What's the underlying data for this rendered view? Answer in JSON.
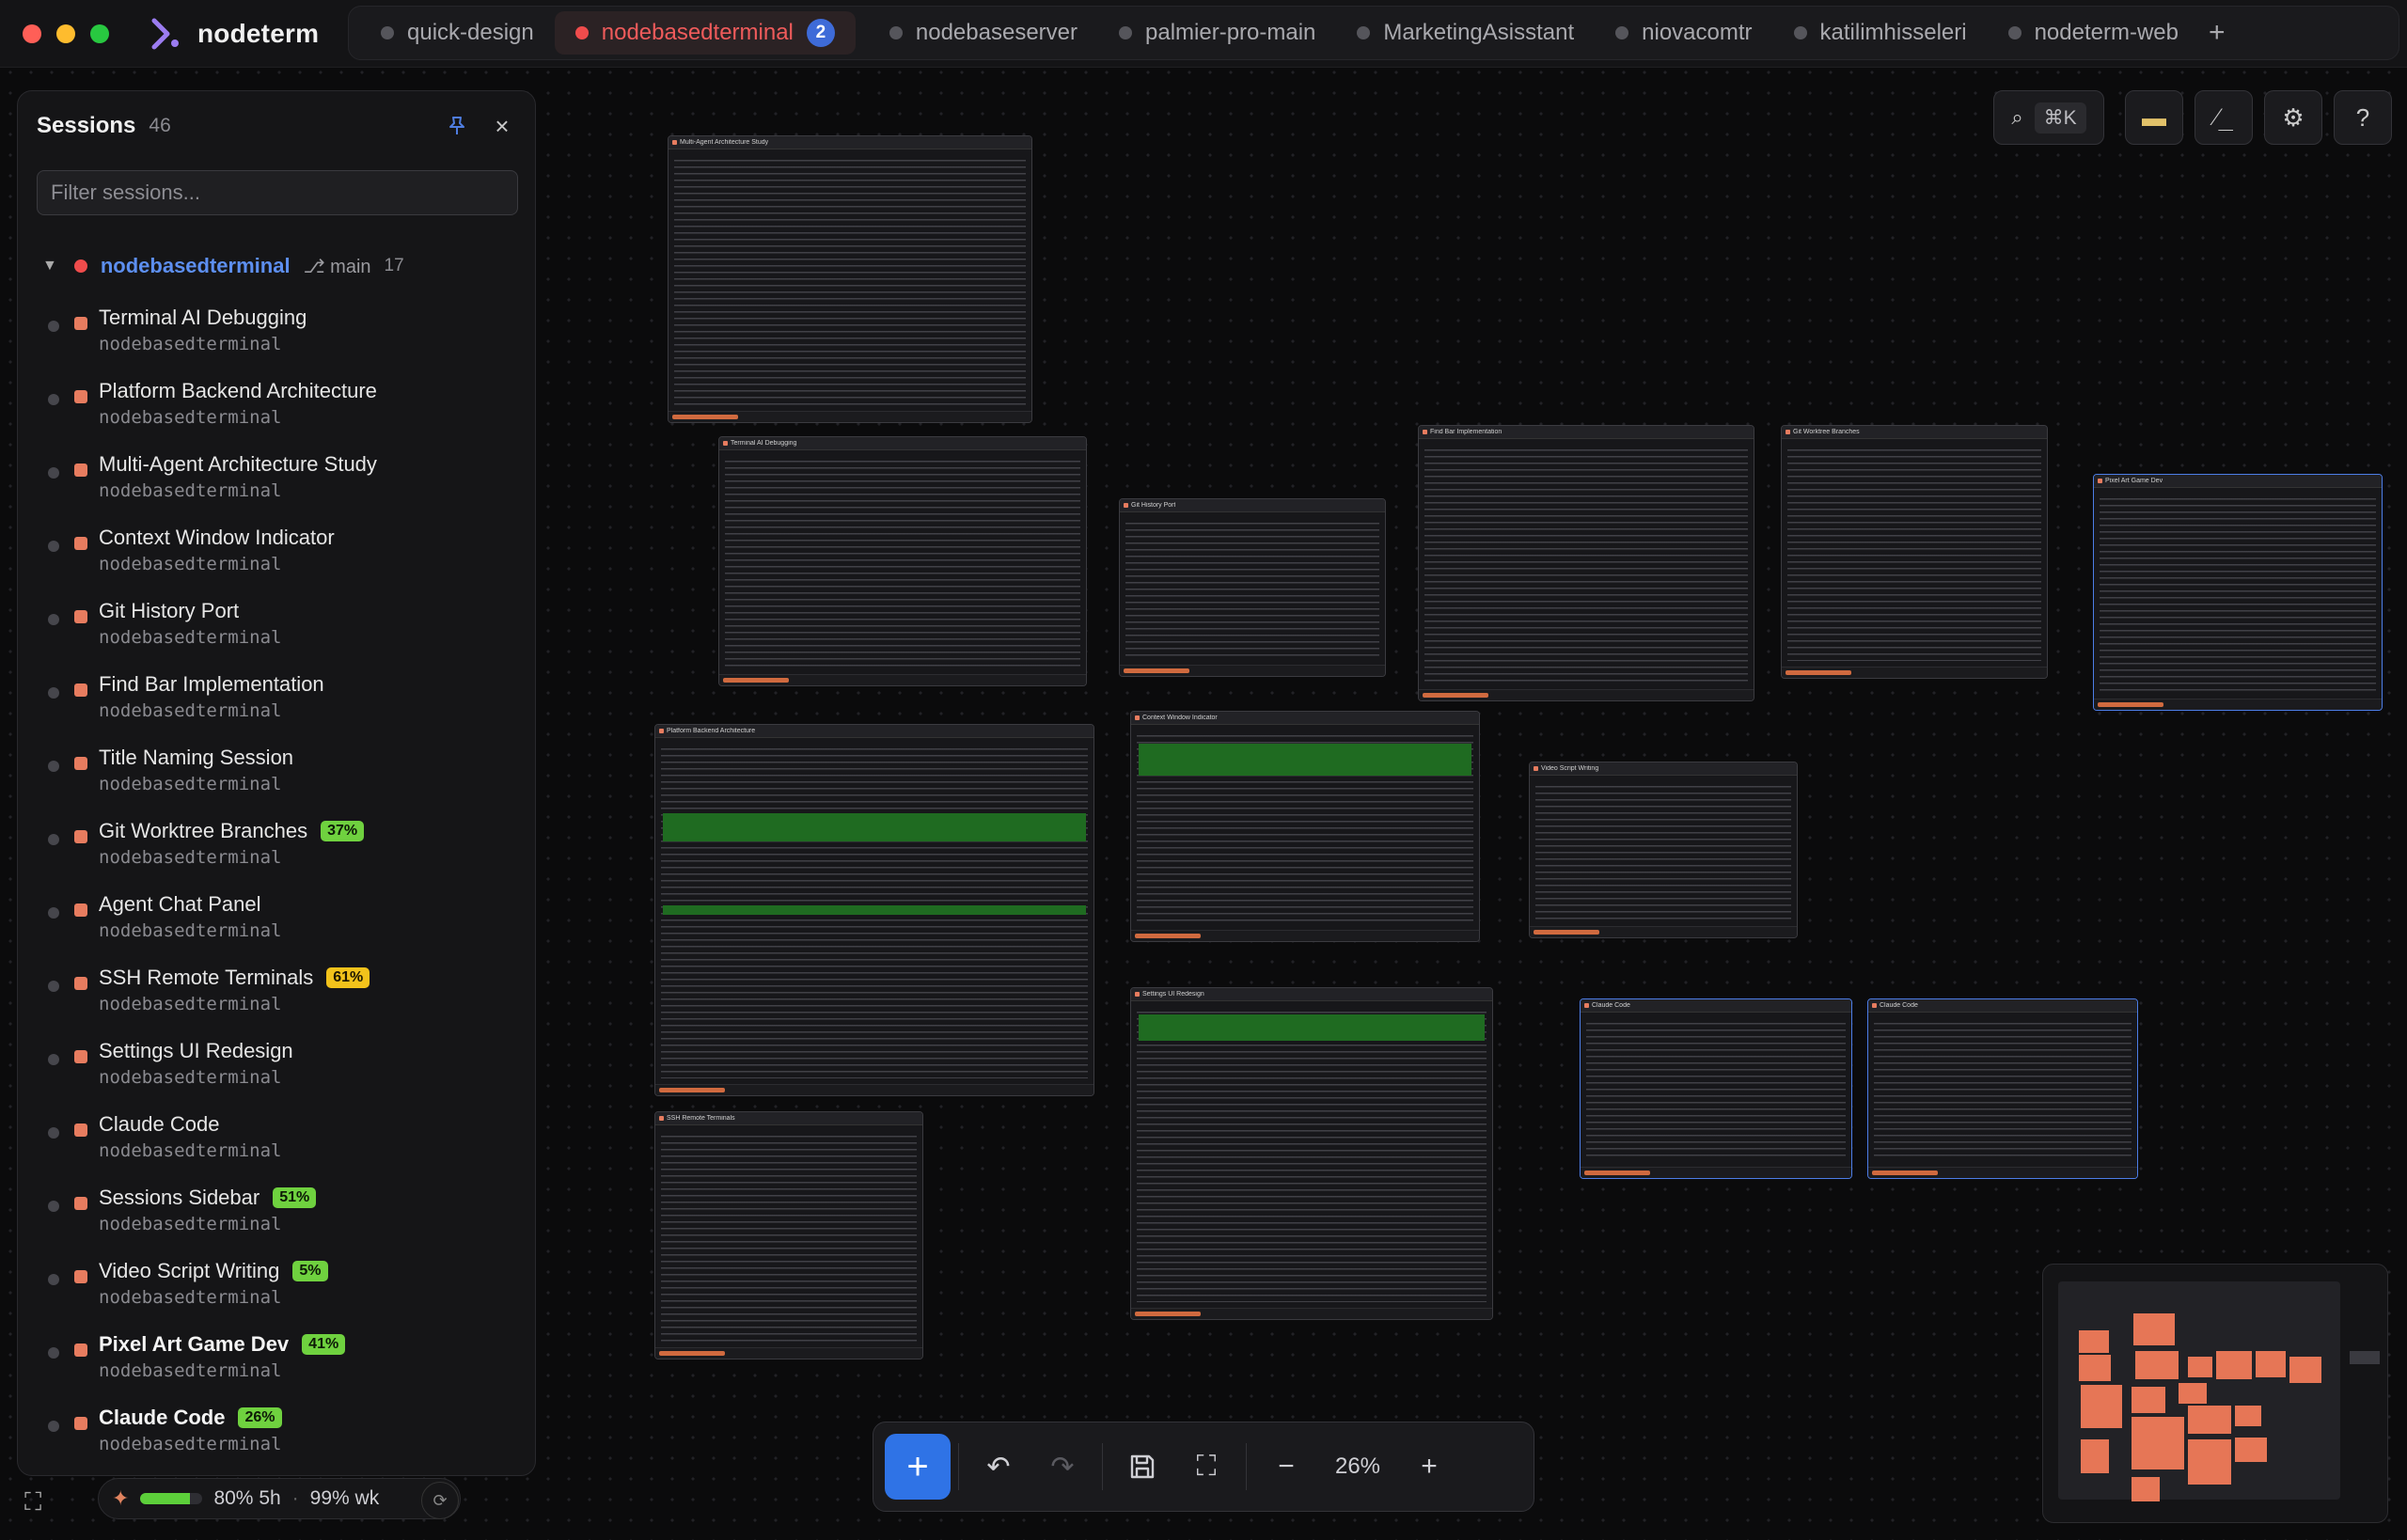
{
  "app": {
    "name": "nodeterm"
  },
  "traffic_colors": {
    "close": "#ff5f57",
    "minimize": "#febc2e",
    "maximize": "#28c840"
  },
  "tabs": [
    {
      "label": "quick-design",
      "active": false
    },
    {
      "label": "nodebasedterminal",
      "active": true,
      "badge": "2"
    },
    {
      "label": "nodebaseserver",
      "active": false
    },
    {
      "label": "palmier-pro-main",
      "active": false
    },
    {
      "label": "MarketingAsisstant",
      "active": false
    },
    {
      "label": "niovacomtr",
      "active": false
    },
    {
      "label": "katilimhisseleri",
      "active": false
    },
    {
      "label": "nodeterm-web",
      "active": false
    }
  ],
  "tabs_add": "+",
  "sidebar": {
    "title": "Sessions",
    "count": "46",
    "filter_placeholder": "Filter sessions...",
    "close": "×",
    "group": {
      "name": "nodebasedterminal",
      "branch": "main",
      "count": "17"
    },
    "sessions": [
      {
        "title": "Terminal AI Debugging",
        "project": "nodebasedterminal"
      },
      {
        "title": "Platform Backend Architecture",
        "project": "nodebasedterminal"
      },
      {
        "title": "Multi-Agent Architecture Study",
        "project": "nodebasedterminal"
      },
      {
        "title": "Context Window Indicator",
        "project": "nodebasedterminal"
      },
      {
        "title": "Git History Port",
        "project": "nodebasedterminal"
      },
      {
        "title": "Find Bar Implementation",
        "project": "nodebasedterminal"
      },
      {
        "title": "Title Naming Session",
        "project": "nodebasedterminal"
      },
      {
        "title": "Git Worktree Branches",
        "project": "nodebasedterminal",
        "pct": "37%",
        "pct_color": "green"
      },
      {
        "title": "Agent Chat Panel",
        "project": "nodebasedterminal"
      },
      {
        "title": "SSH Remote Terminals",
        "project": "nodebasedterminal",
        "pct": "61%",
        "pct_color": "yellow"
      },
      {
        "title": "Settings UI Redesign",
        "project": "nodebasedterminal"
      },
      {
        "title": "Claude Code",
        "project": "nodebasedterminal"
      },
      {
        "title": "Sessions Sidebar",
        "project": "nodebasedterminal",
        "pct": "51%",
        "pct_color": "green"
      },
      {
        "title": "Video Script Writing",
        "project": "nodebasedterminal",
        "pct": "5%",
        "pct_color": "green"
      },
      {
        "title": "Pixel Art Game Dev",
        "project": "nodebasedterminal",
        "pct": "41%",
        "pct_color": "green",
        "bold": true
      },
      {
        "title": "Claude Code",
        "project": "nodebasedterminal",
        "pct": "26%",
        "pct_color": "green",
        "bold": true
      }
    ]
  },
  "usage": {
    "session_pct": "80%",
    "session_window": "5h",
    "weekly": "99% wk",
    "session_fill": 0.8
  },
  "toolbar_top": {
    "search_shortcut": "⌘K"
  },
  "cards": [
    {
      "title": "Multi-Agent Architecture Study"
    },
    {
      "title": "Terminal AI Debugging"
    },
    {
      "title": "Git History Port"
    },
    {
      "title": "Find Bar Implementation"
    },
    {
      "title": "Git Worktree Branches"
    },
    {
      "title": "Pixel Art Game Dev"
    },
    {
      "title": "Platform Backend Architecture"
    },
    {
      "title": "Context Window Indicator"
    },
    {
      "title": "Video Script Writing"
    },
    {
      "title": "Settings UI Redesign"
    },
    {
      "title": "SSH Remote Terminals"
    },
    {
      "title": "Claude Code"
    },
    {
      "title": "Claude Code"
    }
  ],
  "zoom": "26%"
}
